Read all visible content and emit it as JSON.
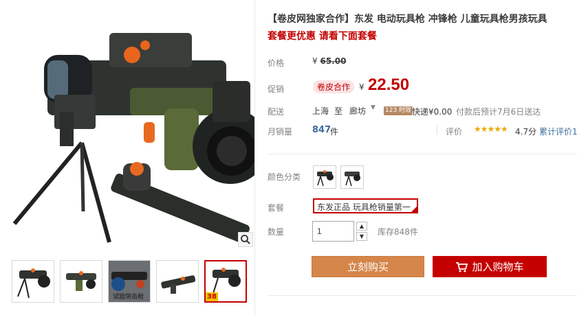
{
  "product": {
    "title": "【卷皮网独家合作】东发 电动玩具枪 冲锋枪 儿童玩具枪男孩玩具",
    "subtitle": "套餐更优惠 请看下面套餐"
  },
  "price": {
    "label": "价格",
    "currency": "¥",
    "original": "65.00"
  },
  "promo": {
    "label": "促销",
    "tag": "卷皮合作",
    "currency": "¥",
    "price": "22.50"
  },
  "shipping": {
    "label": "配送",
    "from": "上海",
    "to_word": "至",
    "to": "廊坊",
    "time_badge": "123 时效",
    "fee": "快递¥0.00",
    "estimate": "付款后预计7月6日送达"
  },
  "sales": {
    "label": "月销量",
    "count": "847",
    "unit": "件",
    "rating_label": "评价",
    "stars": "★★★★★",
    "rating": "4.7分",
    "cumulative_review": "累计评价1"
  },
  "color": {
    "label": "颜色分类"
  },
  "package": {
    "label": "套餐",
    "selected": "东发正品 玩具枪销量第一"
  },
  "quantity": {
    "label": "数量",
    "value": "1",
    "stock": "库存848件"
  },
  "actions": {
    "buy_now": "立刻购买",
    "add_cart": "加入购物车"
  },
  "thumbs": {
    "caption_3": "试验突击枪",
    "badge_5": "38"
  },
  "colors": {
    "accent_red": "#c40000",
    "buy_orange": "#d5864a",
    "link_blue": "#3c6ea0",
    "star_gold": "#e8a900"
  }
}
